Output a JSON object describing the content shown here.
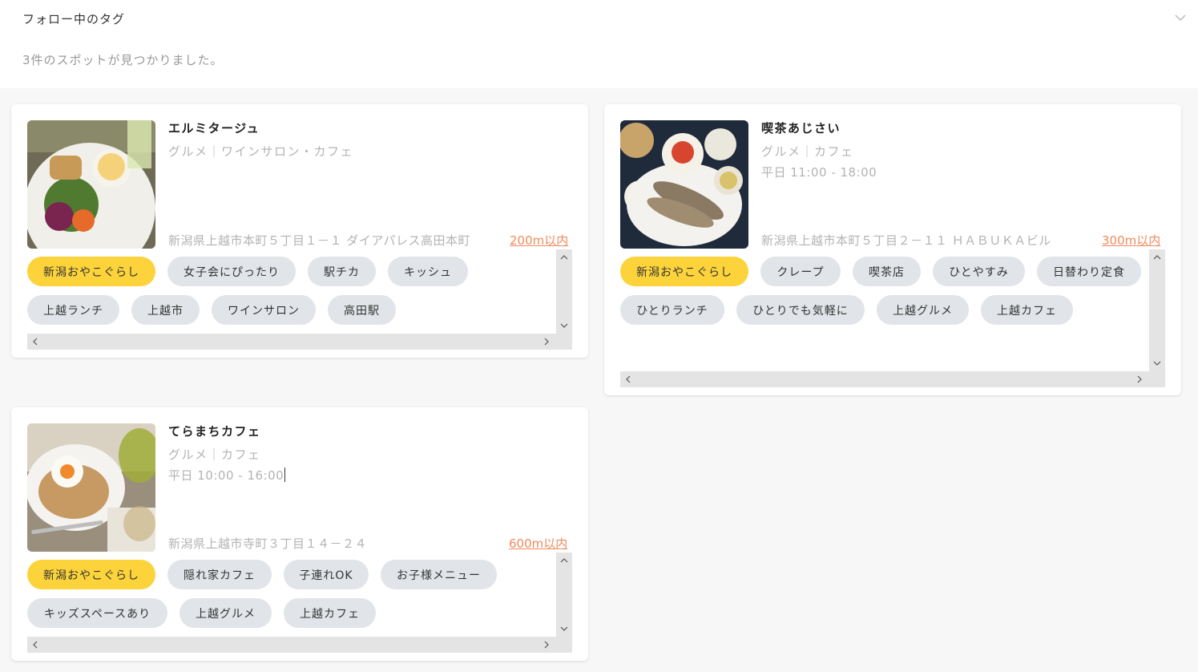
{
  "header": {
    "title": "フォロー中のタグ",
    "result_count": "3件のスポットが見つかりました。"
  },
  "spots": [
    {
      "name": "エルミタージュ",
      "category": "グルメ｜ワインサロン・カフェ",
      "hours": "",
      "address": "新潟県上越市本町５丁目１－１ ダイアパレス高田本町",
      "distance": "200m以内",
      "tags": [
        "新潟おやこぐらし",
        "女子会にぴったり",
        "駅チカ",
        "キッシュ",
        "上越ランチ",
        "上越市",
        "ワインサロン",
        "高田駅"
      ]
    },
    {
      "name": "喫茶あじさい",
      "category": "グルメ｜カフェ",
      "hours": "平日 11:00 - 18:00",
      "address": "新潟県上越市本町５丁目２－１１ ＨＡＢＵＫＡビル",
      "distance": "300m以内",
      "tags": [
        "新潟おやこぐらし",
        "クレープ",
        "喫茶店",
        "ひとやすみ",
        "日替わり定食",
        "ひとりランチ",
        "ひとりでも気軽に",
        "上越グルメ",
        "上越カフェ"
      ]
    },
    {
      "name": "てらまちカフェ",
      "category": "グルメ｜カフェ",
      "hours": "平日 10:00 - 16:00",
      "address": "新潟県上越市寺町３丁目１４－２４",
      "distance": "600m以内",
      "tags": [
        "新潟おやこぐらし",
        "隠れ家カフェ",
        "子連れOK",
        "お子様メニュー",
        "キッズスペースあり",
        "上越グルメ",
        "上越カフェ"
      ]
    }
  ],
  "icons": {
    "expand": "chevron-down-icon",
    "scroll_up": "scroll-up-arrow-icon",
    "scroll_down": "scroll-down-arrow-icon",
    "scroll_left": "scroll-left-arrow-icon",
    "scroll_right": "scroll-right-arrow-icon"
  },
  "colors": {
    "highlight_tag": "#fcd33a",
    "tag": "#e1e4e8",
    "distance": "#f08a5d"
  }
}
